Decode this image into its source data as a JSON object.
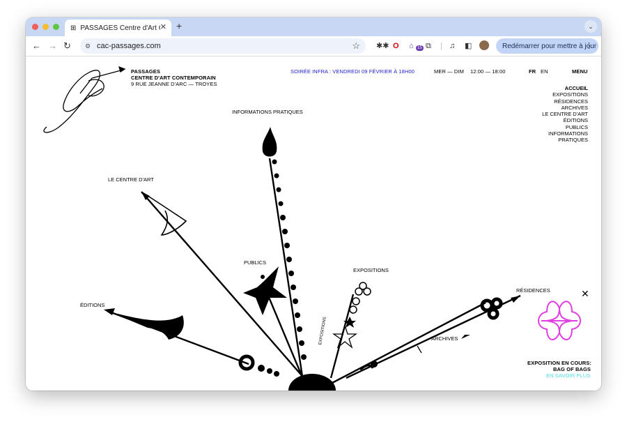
{
  "browser": {
    "tab_title": "PASSAGES Centre d'Art Cont",
    "url": "cac-passages.com",
    "update_button": "Redémarrer pour mettre à jour",
    "badge_count": "15"
  },
  "site": {
    "name": "PASSAGES",
    "subtitle": "CENTRE D'ART CONTEMPORAIN",
    "address": "9 RUE JEANNE D'ARC — TROYES",
    "announcement": "SOIRÉE INFRA : VENDREDI 09 FÉVRIER À 18H00",
    "days": "MER — DIM",
    "hours": "12:00 — 18:00",
    "lang_fr": "FR",
    "lang_en": "EN",
    "menu_label": "MENU",
    "menu": [
      "ACCUEIL",
      "EXPOSITIONS",
      "RÉSIDENCES",
      "ARCHIVES",
      "LE CENTRE D'ART",
      "ÉDITIONS",
      "PUBLICS",
      "INFORMATIONS",
      "PRATIQUES"
    ]
  },
  "compass": {
    "info": "INFORMATIONS PRATIQUES",
    "centre": "LE CENTRE D'ART",
    "publics": "PUBLICS",
    "expositions": "EXPOSITIONS",
    "residences": "RÉSIDENCES",
    "editions": "ÉDITIONS",
    "archives": "ARCHIVES",
    "small_label": "EXPOSITIONS"
  },
  "exhibition": {
    "label": "EXPOSITION EN COURS:",
    "title": "BAG OF BAGS",
    "cta": "EN SAVOIR PLUS",
    "accent": "#e040e0",
    "cta_color": "#4fd8ee"
  },
  "colors": {
    "announcement": "#2020d0"
  }
}
